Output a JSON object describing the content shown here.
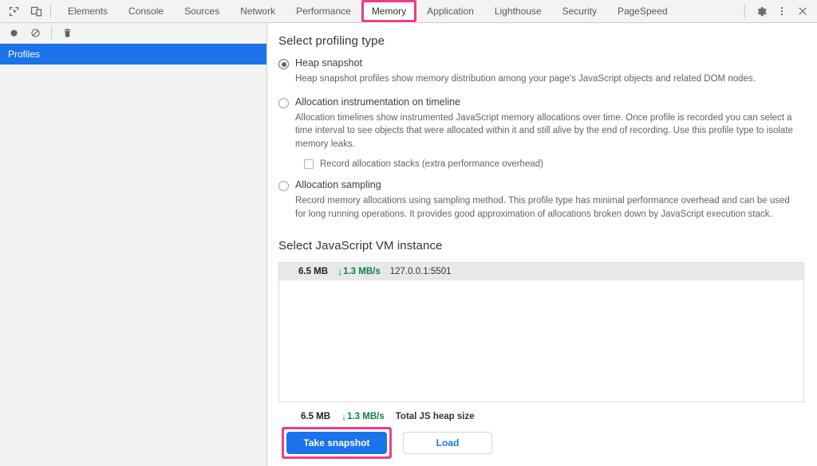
{
  "tabbar": {
    "left_icons": [
      {
        "name": "inspect-element-icon",
        "title": "Inspect element"
      },
      {
        "name": "device-toolbar-icon",
        "title": "Toggle device toolbar"
      }
    ],
    "tabs": [
      {
        "label": "Elements",
        "active": false
      },
      {
        "label": "Console",
        "active": false
      },
      {
        "label": "Sources",
        "active": false
      },
      {
        "label": "Network",
        "active": false
      },
      {
        "label": "Performance",
        "active": false
      },
      {
        "label": "Memory",
        "active": true,
        "highlighted": true
      },
      {
        "label": "Application",
        "active": false
      },
      {
        "label": "Lighthouse",
        "active": false
      },
      {
        "label": "Security",
        "active": false
      },
      {
        "label": "PageSpeed",
        "active": false
      }
    ],
    "right_icons": [
      {
        "name": "gear-icon",
        "glyph": "⚙"
      },
      {
        "name": "kebab-menu-icon",
        "glyph": "⋮"
      },
      {
        "name": "close-icon",
        "glyph": "✕"
      }
    ]
  },
  "sidebar": {
    "toolbar": [
      {
        "name": "record-button",
        "title": "Start recording"
      },
      {
        "name": "clear-button",
        "title": "Clear all profiles"
      },
      {
        "name": "delete-button",
        "title": "Delete profile"
      }
    ],
    "selected_item": "Profiles"
  },
  "main": {
    "profiling_heading": "Select profiling type",
    "options": [
      {
        "label": "Heap snapshot",
        "selected": true,
        "description": "Heap snapshot profiles show memory distribution among your page's JavaScript objects and related DOM nodes."
      },
      {
        "label": "Allocation instrumentation on timeline",
        "selected": false,
        "description": "Allocation timelines show instrumented JavaScript memory allocations over time. Once profile is recorded you can select a time interval to see objects that were allocated within it and still alive by the end of recording. Use this profile type to isolate memory leaks.",
        "checkbox": {
          "label": "Record allocation stacks (extra performance overhead)",
          "checked": false
        }
      },
      {
        "label": "Allocation sampling",
        "selected": false,
        "description": "Record memory allocations using sampling method. This profile type has minimal performance overhead and can be used for long running operations. It provides good approximation of allocations broken down by JavaScript execution stack."
      }
    ],
    "vm_heading": "Select JavaScript VM instance",
    "vm_rows": [
      {
        "size": "6.5 MB",
        "rate": "1.3 MB/s",
        "rate_arrow": "↓",
        "host": "127.0.0.1:5501"
      }
    ],
    "totals": {
      "size": "6.5 MB",
      "rate": "1.3 MB/s",
      "rate_arrow": "↓",
      "label": "Total JS heap size"
    },
    "buttons": {
      "take_snapshot": "Take snapshot",
      "load": "Load"
    }
  },
  "colors": {
    "accent_blue": "#1a73e8",
    "highlight_pink": "#f03a8c",
    "rate_green": "#0b8043"
  }
}
